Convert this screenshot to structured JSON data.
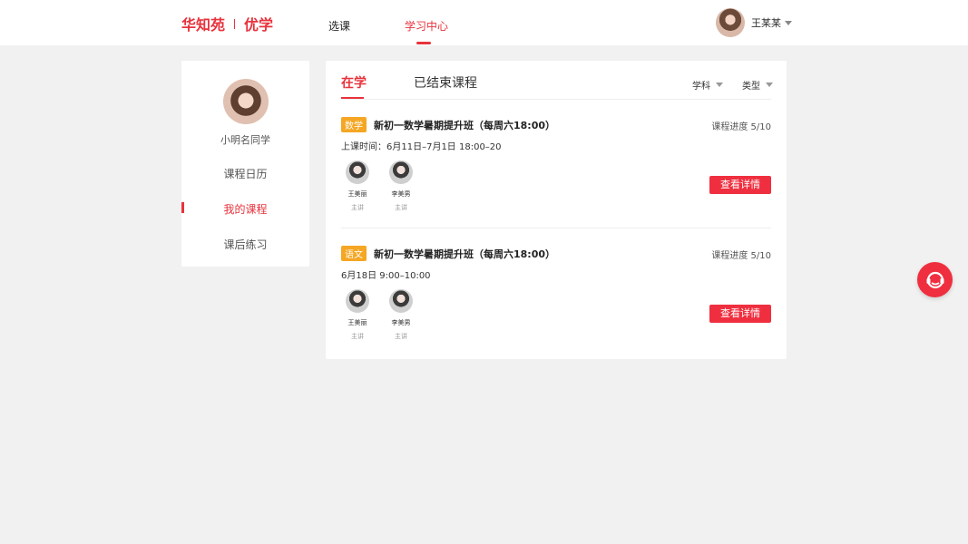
{
  "header": {
    "logo_left": "华知苑",
    "logo_right": "优学",
    "nav": [
      {
        "label": "选课"
      },
      {
        "label": "学习中心"
      }
    ],
    "user_name": "王某某"
  },
  "sidebar": {
    "student_name": "小明名同学",
    "items": [
      {
        "label": "课程日历"
      },
      {
        "label": "我的课程"
      },
      {
        "label": "课后练习"
      }
    ]
  },
  "main": {
    "tabs": [
      {
        "label": "在学"
      },
      {
        "label": "已结束课程"
      }
    ],
    "filters": [
      {
        "label": "学科"
      },
      {
        "label": "类型"
      }
    ],
    "courses": [
      {
        "subject": "数学",
        "title": "新初一数学暑期提升班（每周六18:00）",
        "progress": "课程进度 5/10",
        "time": "上课时间：6月11日–7月1日  18:00–20",
        "teachers": [
          {
            "name": "王美丽",
            "role": "主讲"
          },
          {
            "name": "李美男",
            "role": "主讲"
          }
        ],
        "button": "查看详情"
      },
      {
        "subject": "语文",
        "title": "新初一数学暑期提升班（每周六18:00）",
        "progress": "课程进度 5/10",
        "time": "6月18日  9:00–10:00",
        "teachers": [
          {
            "name": "王美丽",
            "role": "主讲"
          },
          {
            "name": "李美男",
            "role": "主讲"
          }
        ],
        "button": "查看详情"
      }
    ]
  },
  "colors": {
    "accent": "#e8323c",
    "badge": "#f5a623",
    "background": "#f1f1f1"
  },
  "icons": {
    "service": "customer-service-headset-icon"
  }
}
